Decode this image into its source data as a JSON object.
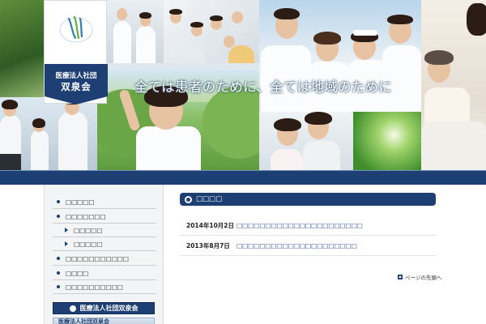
{
  "org": {
    "line1": "医療法人社団",
    "line2": "双泉会"
  },
  "slogan": "全ては患者のために、全ては地域のために",
  "sidebar": {
    "items": [
      {
        "label": "□□□□□"
      },
      {
        "label": "□□□□□□□"
      },
      {
        "label": "□□□□□"
      },
      {
        "label": "□□□□□"
      },
      {
        "label": "□□□□□□□□□□□"
      },
      {
        "label": "□□□□"
      },
      {
        "label": "□□□□□□□□□□"
      }
    ],
    "banner": "医療法人社団双泉会",
    "banner2": "医療法人社団双泉会"
  },
  "news": {
    "heading": "□□□□",
    "items": [
      {
        "date": "2014年10月2日",
        "title": "□□□□□□□□□□□□□□□□□□□□□□"
      },
      {
        "date": "2013年8月7日",
        "title": "□□□□□□□□□□□□□□□□□□□□□"
      }
    ]
  },
  "pagetop": "ページの先頭へ",
  "colors": {
    "navy": "#1d3f73",
    "link": "#1d3f9a"
  }
}
